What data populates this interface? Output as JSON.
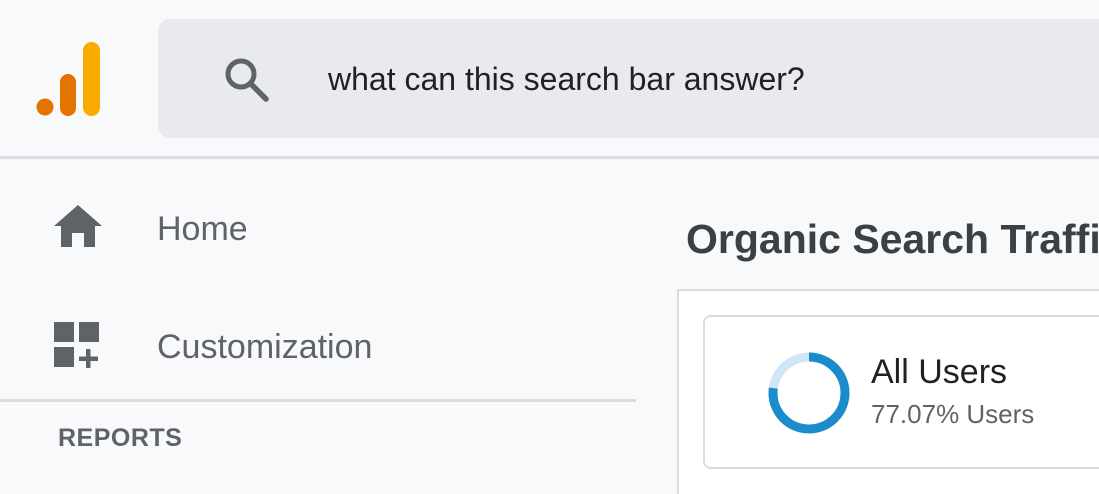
{
  "app": {
    "logo_icon": "analytics-logo-icon"
  },
  "search": {
    "icon": "search-icon",
    "placeholder": "what can this search bar answer?"
  },
  "sidebar": {
    "items": [
      {
        "label": "Home",
        "icon": "home-icon"
      },
      {
        "label": "Customization",
        "icon": "customization-icon"
      }
    ],
    "section_label": "REPORTS"
  },
  "main": {
    "title": "Organic Search Traffic",
    "segment": {
      "name": "All Users",
      "subtitle": "77.07% Users",
      "percent": 77.07
    }
  },
  "colors": {
    "logo_light": "#f9ab00",
    "logo_dark": "#e37400",
    "donut_fill": "#1a8ccb",
    "donut_track": "#cfe6f5"
  }
}
